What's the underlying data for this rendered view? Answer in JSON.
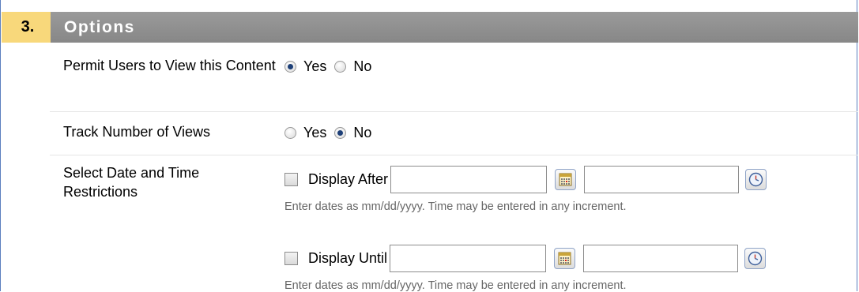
{
  "section": {
    "number": "3.",
    "title": "Options"
  },
  "permit_view": {
    "label": "Permit Users to View this Content",
    "options": [
      "Yes",
      "No"
    ],
    "selected": "Yes"
  },
  "track_views": {
    "label": "Track Number of Views",
    "options": [
      "Yes",
      "No"
    ],
    "selected": "No"
  },
  "date_restrictions": {
    "label": "Select Date and Time Restrictions",
    "display_after": {
      "label": "Display After",
      "date_value": "",
      "time_value": "",
      "hint": "Enter dates as mm/dd/yyyy. Time may be entered in any increment."
    },
    "display_until": {
      "label": "Display Until",
      "date_value": "",
      "time_value": "",
      "hint": "Enter dates as mm/dd/yyyy. Time may be entered in any increment."
    }
  },
  "icons": {
    "calendar": "calendar-icon",
    "clock": "clock-icon"
  },
  "colors": {
    "step_number_bg": "#f8d87b",
    "header_bg": "#8f8f8f",
    "frame_border": "#5b7fbf",
    "radio_selected": "#1d3f77",
    "hint_text": "#666666"
  }
}
